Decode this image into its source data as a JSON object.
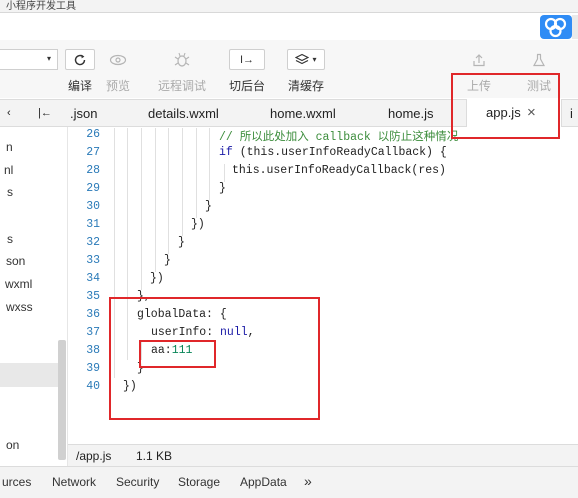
{
  "window": {
    "title": "小程序开发工具"
  },
  "toolbar": {
    "compile_label": "编译",
    "preview_label": "预览",
    "remote_debug_label": "远程调试",
    "background_label": "切后台",
    "clear_cache_label": "清缓存",
    "upload_label": "上传",
    "test_label": "测试",
    "background_button_text": "I→",
    "layers_dropdown_arrow": "▾",
    "select_arrow": "▾"
  },
  "tabs": {
    "items": [
      {
        "label": ".json"
      },
      {
        "label": "details.wxml"
      },
      {
        "label": "home.wxml"
      },
      {
        "label": "home.js"
      },
      {
        "label": "app.js",
        "active": true
      },
      {
        "label": "i"
      }
    ],
    "close_glyph": "×",
    "sidebar_toggle": "‹",
    "collapse_glyph": "|←"
  },
  "sidebar": {
    "items": [
      {
        "label": "n"
      },
      {
        "label": "nl"
      },
      {
        "label": "s"
      },
      {
        "label": "s"
      },
      {
        "label": "son"
      },
      {
        "label": "wxml"
      },
      {
        "label": "wxss"
      },
      {
        "label": "on"
      }
    ]
  },
  "editor": {
    "line_numbers": [
      "26",
      "27",
      "28",
      "29",
      "30",
      "31",
      "32",
      "33",
      "34",
      "35",
      "36",
      "37",
      "38",
      "39",
      "40"
    ],
    "lines": {
      "l26": "// 所以此处加入 callback 以防止这种情况",
      "l27_kw": "if",
      "l27_rest": " (this.userInfoReadyCallback) {",
      "l28": "this.userInfoReadyCallback(res)",
      "l29": "}",
      "l30": "}",
      "l31": "})",
      "l32": "}",
      "l33": "}",
      "l34": "})",
      "l35": "},",
      "l36": "globalData: {",
      "l37_key": "userInfo: ",
      "l37_val": "null",
      "l37_end": ",",
      "l38_key": "aa:",
      "l38_val": "111",
      "l39": "}",
      "l40": "})"
    }
  },
  "status": {
    "path": "/app.js",
    "size": "1.1 KB"
  },
  "bottom_tabs": {
    "items": [
      {
        "label": "urces"
      },
      {
        "label": "Network"
      },
      {
        "label": "Security"
      },
      {
        "label": "Storage"
      },
      {
        "label": "AppData"
      },
      {
        "label": "»"
      }
    ]
  },
  "colors": {
    "accent": "#2f8cf5",
    "annotation": "#e0272a",
    "line_number": "#2a7ab8",
    "comment": "#3c8d3c",
    "keyword": "#1a1aa6",
    "number": "#098658"
  }
}
